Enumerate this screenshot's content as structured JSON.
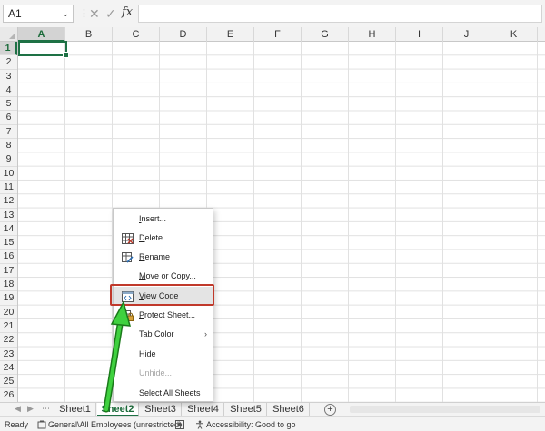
{
  "formula_bar": {
    "name_box": "A1",
    "name_box_caret": "⌄",
    "separator": "⋮",
    "cancel_glyph": "✕",
    "enter_glyph": "✓",
    "fx_label": "fx",
    "formula_value": ""
  },
  "grid": {
    "columns": [
      "A",
      "B",
      "C",
      "D",
      "E",
      "F",
      "G",
      "H",
      "I",
      "J",
      "K"
    ],
    "rows": [
      "1",
      "2",
      "3",
      "4",
      "5",
      "6",
      "7",
      "8",
      "9",
      "10",
      "11",
      "12",
      "13",
      "14",
      "15",
      "16",
      "17",
      "18",
      "19",
      "20",
      "21",
      "22",
      "23",
      "24",
      "25",
      "26"
    ],
    "active_column": "A",
    "active_row": "1"
  },
  "sheet_tabs": {
    "prev_glyph": "◀",
    "next_glyph": "▶",
    "more_glyph": "⋯",
    "tabs": [
      "Sheet1",
      "Sheet2",
      "Sheet3",
      "Sheet4",
      "Sheet5",
      "Sheet6"
    ],
    "active_tab": "Sheet2",
    "add_glyph": "+"
  },
  "context_menu": {
    "items": [
      {
        "label": "Insert...",
        "underline": "I",
        "rest": "nsert...",
        "icon": "none",
        "disabled": false
      },
      {
        "label": "Delete",
        "underline": "D",
        "rest": "elete",
        "icon": "delete-sheet-icon",
        "disabled": false
      },
      {
        "label": "Rename",
        "underline": "R",
        "rest": "ename",
        "icon": "rename-sheet-icon",
        "disabled": false
      },
      {
        "label": "Move or Copy...",
        "underline": "M",
        "rest": "ove or Copy...",
        "icon": "none",
        "disabled": false
      },
      {
        "label": "View Code",
        "underline": "V",
        "rest": "iew Code",
        "icon": "view-code-icon",
        "disabled": false
      },
      {
        "label": "Protect Sheet...",
        "underline": "P",
        "rest": "rotect Sheet...",
        "icon": "protect-sheet-icon",
        "disabled": false
      },
      {
        "label": "Tab Color",
        "underline": "T",
        "rest": "ab Color",
        "icon": "none",
        "disabled": false,
        "submenu_glyph": "›"
      },
      {
        "label": "Hide",
        "underline": "H",
        "rest": "ide",
        "icon": "none",
        "disabled": false
      },
      {
        "label": "Unhide...",
        "underline": "U",
        "rest": "nhide...",
        "icon": "none",
        "disabled": true
      },
      {
        "label": "Select All Sheets",
        "underline": "S",
        "rest": "elect All Sheets",
        "icon": "none",
        "disabled": false
      }
    ],
    "highlighted_item": "View Code"
  },
  "status_bar": {
    "ready": "Ready",
    "sensitivity": "General\\All Employees (unrestricted)",
    "accessibility": "Accessibility: Good to go"
  },
  "colors": {
    "excel_green": "#1e7145",
    "highlight_red": "#c0392b",
    "arrow_green": "#3fd13f"
  }
}
